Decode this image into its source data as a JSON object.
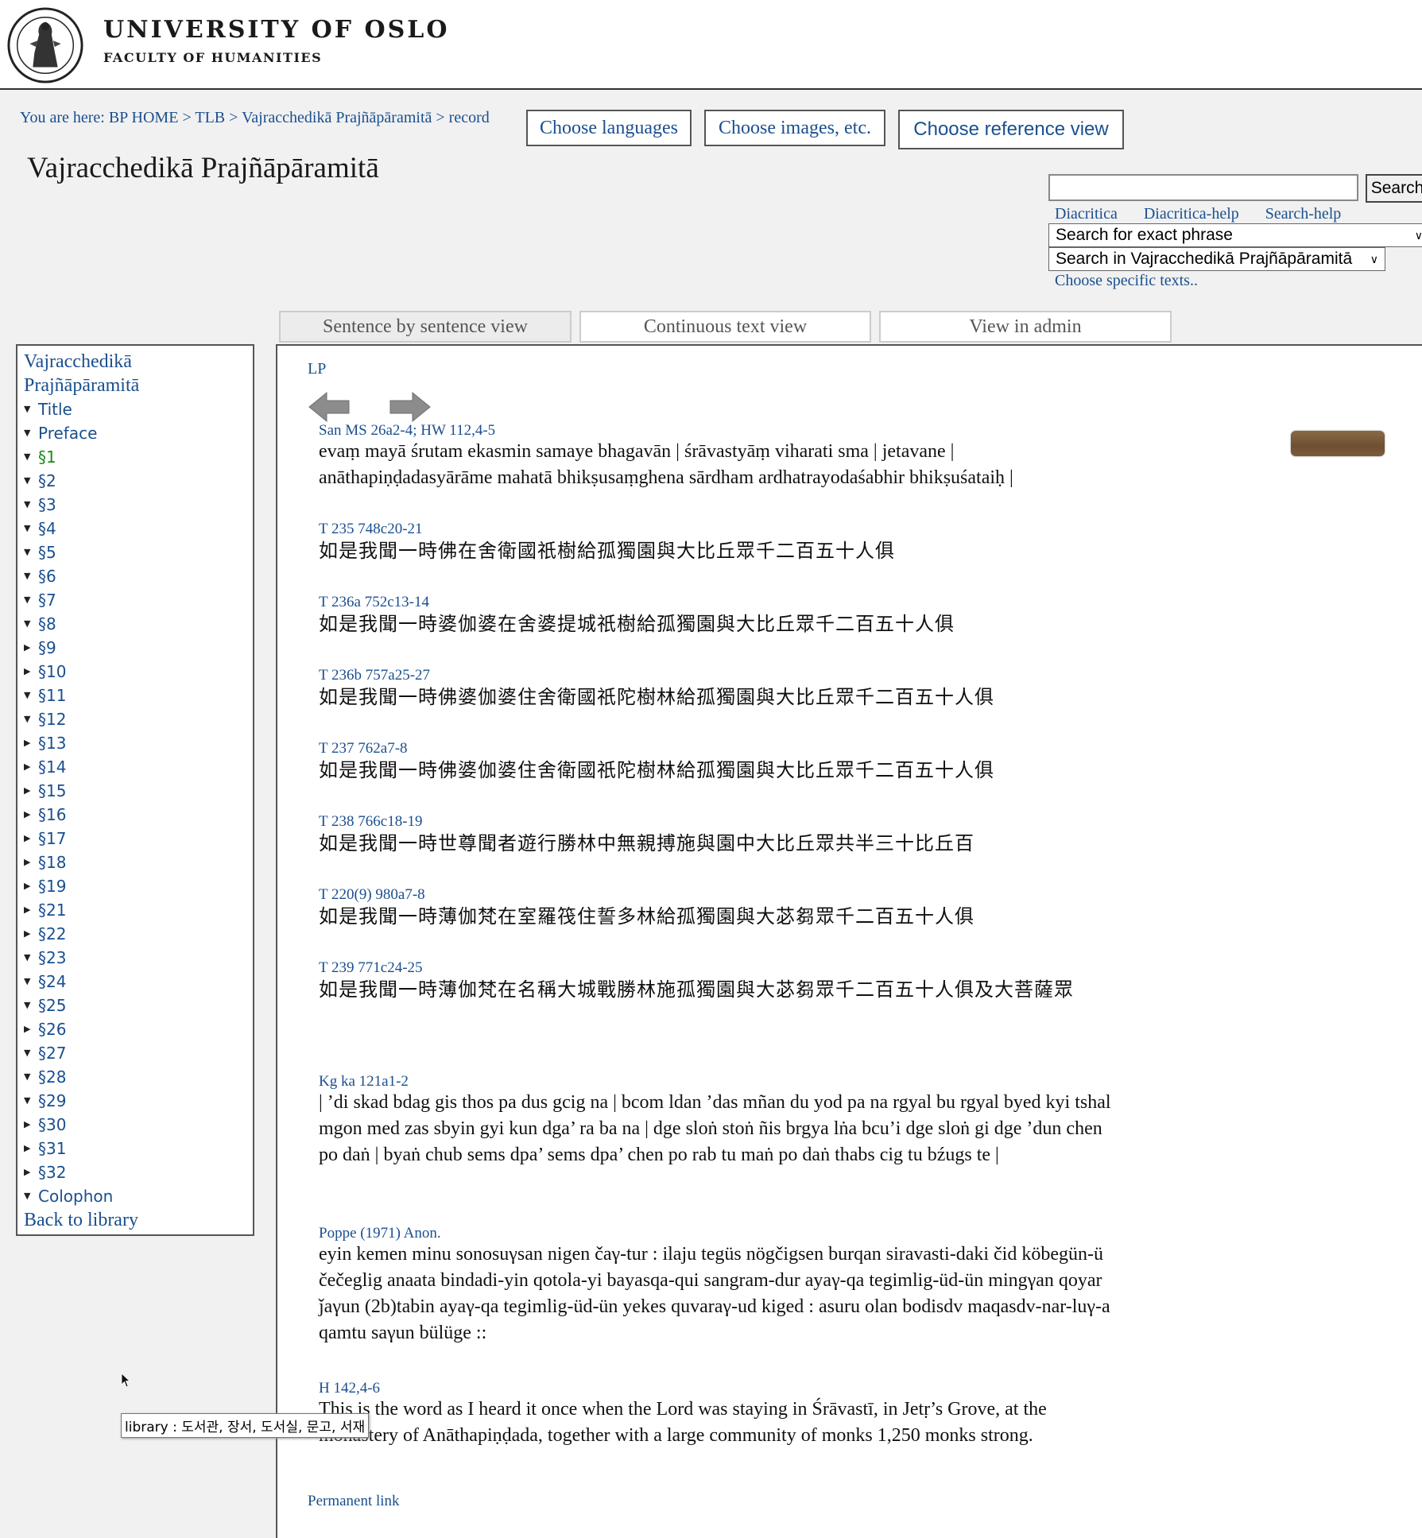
{
  "header": {
    "university": "UNIVERSITY OF OSLO",
    "faculty": "FACULTY OF HUMANITIES",
    "seal_icon": "university-seal-icon"
  },
  "breadcrumb": {
    "prefix": "You are here: ",
    "items": [
      "BP HOME",
      "TLB",
      "Vajracchedikā Prajñāpāramitā"
    ],
    "current": "record",
    "separator": " > "
  },
  "buttons": {
    "languages": "Choose languages",
    "images": "Choose images, etc.",
    "reference": "Choose reference view"
  },
  "title": "Vajracchedikā Prajñāpāramitā",
  "search": {
    "button": "Search",
    "value": "",
    "links": [
      "Diacritica",
      "Diacritica-help",
      "Search-help"
    ],
    "mode": "Search for exact phrase",
    "scope": "Search in Vajracchedikā Prajñāpāramitā",
    "choose_texts": "Choose specific texts.."
  },
  "tabs": [
    "Sentence by sentence view",
    "Continuous text view",
    "View in admin"
  ],
  "sidebar": {
    "root": "Vajracchedikā Prajñāpāramitā",
    "items": [
      {
        "label": "Title",
        "expanded": true
      },
      {
        "label": "Preface",
        "expanded": true
      },
      {
        "label": "§1",
        "expanded": true,
        "current": true
      },
      {
        "label": "§2",
        "expanded": true
      },
      {
        "label": "§3",
        "expanded": true
      },
      {
        "label": "§4",
        "expanded": true
      },
      {
        "label": "§5",
        "expanded": true
      },
      {
        "label": "§6",
        "expanded": true
      },
      {
        "label": "§7",
        "expanded": true
      },
      {
        "label": "§8",
        "expanded": true
      },
      {
        "label": "§9",
        "expanded": false
      },
      {
        "label": "§10",
        "expanded": false
      },
      {
        "label": "§11",
        "expanded": true
      },
      {
        "label": "§12",
        "expanded": true
      },
      {
        "label": "§13",
        "expanded": false
      },
      {
        "label": "§14",
        "expanded": false
      },
      {
        "label": "§15",
        "expanded": false
      },
      {
        "label": "§16",
        "expanded": false
      },
      {
        "label": "§17",
        "expanded": false
      },
      {
        "label": "§18",
        "expanded": false
      },
      {
        "label": "§19",
        "expanded": false
      },
      {
        "label": "§21",
        "expanded": false
      },
      {
        "label": "§22",
        "expanded": false
      },
      {
        "label": "§23",
        "expanded": true
      },
      {
        "label": "§24",
        "expanded": true
      },
      {
        "label": "§25",
        "expanded": true
      },
      {
        "label": "§26",
        "expanded": false
      },
      {
        "label": "§27",
        "expanded": true
      },
      {
        "label": "§28",
        "expanded": true
      },
      {
        "label": "§29",
        "expanded": true
      },
      {
        "label": "§30",
        "expanded": false
      },
      {
        "label": "§31",
        "expanded": false
      },
      {
        "label": "§32",
        "expanded": false
      },
      {
        "label": "Colophon",
        "expanded": true
      }
    ],
    "back": "Back to library"
  },
  "content": {
    "lp": "LP",
    "permanent_link": "Permanent link",
    "records": [
      {
        "ref": "San MS 26a2-4; HW 112,4-5",
        "text": "evaṃ mayā śrutam ekasmin samaye bhagavān | śrāvastyāṃ viharati sma | jetavane | anāthapiṇḍadasyārāme mahatā bhikṣusaṃghena sārdham ardhatrayodaśabhir bhikṣuśataiḥ |"
      },
      {
        "ref": "T 235 748c20-21",
        "text": "如是我聞一時佛在舍衛國祇樹給孤獨園與大比丘眾千二百五十人俱",
        "cjk": true
      },
      {
        "ref": "T 236a 752c13-14",
        "text": "如是我聞一時婆伽婆在舍婆提城祇樹給孤獨園與大比丘眾千二百五十人俱",
        "cjk": true
      },
      {
        "ref": "T 236b 757a25-27",
        "text": "如是我聞一時佛婆伽婆住舍衛國祇陀樹林給孤獨園與大比丘眾千二百五十人俱",
        "cjk": true
      },
      {
        "ref": "T 237 762a7-8",
        "text": "如是我聞一時佛婆伽婆住舍衛國祇陀樹林給孤獨園與大比丘眾千二百五十人俱",
        "cjk": true
      },
      {
        "ref": "T 238 766c18-19",
        "text": "如是我聞一時世尊聞者遊行勝林中無親搏施與園中大比丘眾共半三十比丘百",
        "cjk": true
      },
      {
        "ref": "T 220(9) 980a7-8",
        "text": "如是我聞一時薄伽梵在室羅筏住誓多林給孤獨園與大苾芻眾千二百五十人俱",
        "cjk": true
      },
      {
        "ref": "T 239 771c24-25",
        "text": "如是我聞一時薄伽梵在名稱大城戰勝林施孤獨園與大苾芻眾千二百五十人俱及大菩薩眾",
        "cjk": true
      },
      {
        "ref": "Kg ka 121a1-2",
        "text": "| ’di skad bdag gis thos pa dus gcig na | bcom ldan ’das mñan du yod pa na rgyal bu rgyal byed kyi tshal mgon med zas sbyin gyi kun dga’ ra ba na | dge sloṅ stoṅ ñis brgya lṅa bcu’i dge sloṅ gi dge ’dun chen po daṅ | byaṅ chub sems dpa’ sems dpa’ chen po rab tu maṅ po daṅ thabs cig tu bźugs te |"
      },
      {
        "ref": "Poppe (1971) Anon.",
        "text": "eyin kemen minu sonosuγsan nigen čaγ-tur : ilaju tegüs nögčigsen burqan siravasti-daki čid köbegün-ü čečeglig anaata bindadi-yin qotola-yi bayasqa-qui sangram-dur ayaγ-qa tegimlig-üd-ün mingγan qoyar ǰaγun (2b)tabin ayaγ-qa tegimlig-üd-ün yekes quvaraγ-ud kiged : asuru olan bodisdv maqasdv-nar-luγ-a qamtu saγun bülüge ::"
      },
      {
        "ref": "H 142,4-6",
        "text": "This is the word as I heard it once when the Lord was staying in Śrāvastī, in Jetṛ’s Grove, at the monastery of Anāthapiṇḍada, together with a large community of monks 1,250 monks strong."
      }
    ]
  },
  "tooltip": "library : 도서관, 장서, 도서실, 문고, 서재",
  "icons": {
    "prev": "arrow-left-icon",
    "next": "arrow-right-icon",
    "manuscript": "manuscript-thumbnail",
    "cursor": "mouse-cursor-icon"
  }
}
